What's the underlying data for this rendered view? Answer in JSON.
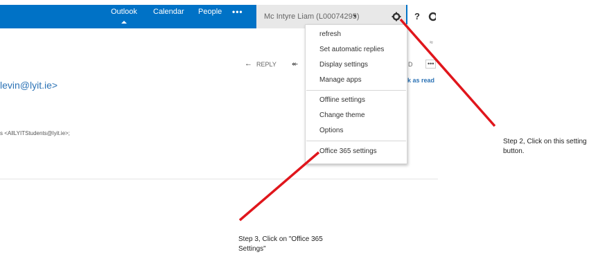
{
  "colors": {
    "topbar": "#0072c6",
    "link": "#2b72b5",
    "annotation_arrow": "#e0161c"
  },
  "nav": {
    "outlook": "Outlook",
    "calendar": "Calendar",
    "people": "People",
    "more": "•••"
  },
  "user": {
    "name": "Mc Intyre Liam (L00074295)",
    "caret": "▾"
  },
  "toolbar": {
    "gear_icon": "gear",
    "help": "?"
  },
  "dropdown": {
    "items": [
      "refresh",
      "Set automatic replies",
      "Display settings",
      "Manage apps",
      "Offline settings",
      "Change theme",
      "Options",
      "Office 365 settings"
    ]
  },
  "message": {
    "reply_label": "REPLY",
    "sender_email": "levin@lyit.ie>",
    "recipients": "s <AllLYITStudents@lyit.ie>;",
    "mark_as_read": "k as read",
    "d_fragment": "D",
    "more": "•••"
  },
  "annotations": {
    "step2": "Step 2, Click on this setting button.",
    "step3": "Step 3, Click on \"Office 365 Settings\""
  }
}
